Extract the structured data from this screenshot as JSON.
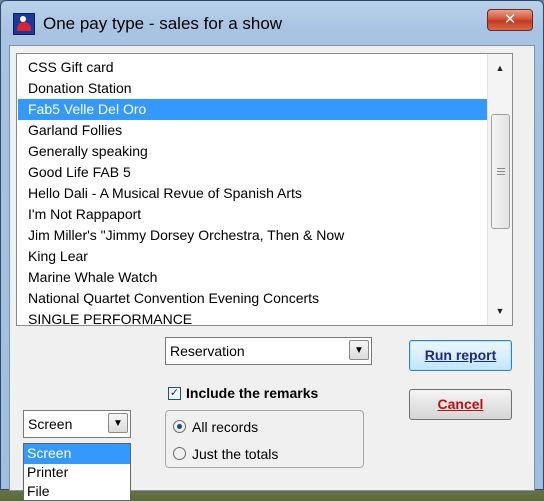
{
  "window": {
    "title": "One pay type - sales for a show",
    "close_glyph": "✕"
  },
  "shows": {
    "items": [
      "CSS Gift card",
      "Donation Station",
      "Fab5 Velle Del Oro",
      "Garland Follies",
      "Generally speaking",
      "Good Life FAB 5",
      "Hello Dali - A Musical Revue of Spanish Arts",
      "I'm Not Rappaport",
      "Jim Miller's \"Jimmy Dorsey Orchestra, Then & Now",
      "King Lear",
      "Marine Whale Watch",
      "National Quartet Convention Evening Concerts",
      "SINGLE PERFORMANCE"
    ],
    "selected_index": 2
  },
  "pay_type_select": {
    "value": "Reservation",
    "arrow": "▼"
  },
  "include_remarks": {
    "label": "Include the remarks",
    "checked": true,
    "check_glyph": "✓"
  },
  "records": {
    "all_label": "All records",
    "totals_label": "Just the totals",
    "selected": "all"
  },
  "output_select": {
    "value": "Screen",
    "arrow": "▼",
    "options": [
      "Screen",
      "Printer",
      "File"
    ],
    "highlighted_index": 0
  },
  "buttons": {
    "run_report": "Run report",
    "cancel": "Cancel"
  },
  "scrollbar": {
    "up": "▲",
    "down": "▼"
  },
  "colors": {
    "selection": "#3399ff",
    "run_text": "#1a2a8a",
    "cancel_text": "#c01010"
  }
}
